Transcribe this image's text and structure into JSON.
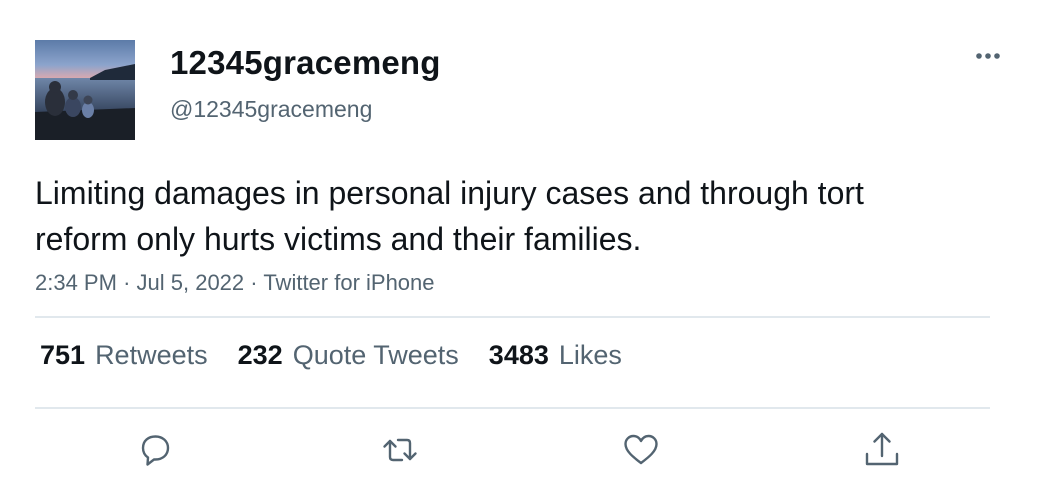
{
  "user": {
    "display_name": "12345gracemeng",
    "handle": "@12345gracemeng",
    "avatar_icon": "profile-photo-lake-sunset"
  },
  "tweet": {
    "text": "Limiting damages in personal injury cases and through tort reform only hurts victims and their families.",
    "time": "2:34 PM",
    "date": "Jul 5, 2022",
    "source": "Twitter for iPhone",
    "separator": "·"
  },
  "stats": [
    {
      "count": "751",
      "label": "Retweets"
    },
    {
      "count": "232",
      "label": "Quote Tweets"
    },
    {
      "count": "3483",
      "label": "Likes"
    }
  ],
  "actions": [
    {
      "name": "reply",
      "icon": "reply-icon"
    },
    {
      "name": "retweet",
      "icon": "retweet-icon"
    },
    {
      "name": "like",
      "icon": "heart-icon"
    },
    {
      "name": "share",
      "icon": "share-icon"
    }
  ],
  "colors": {
    "text_primary": "#0f1419",
    "text_secondary": "#536471",
    "divider": "#e1e8ed"
  }
}
